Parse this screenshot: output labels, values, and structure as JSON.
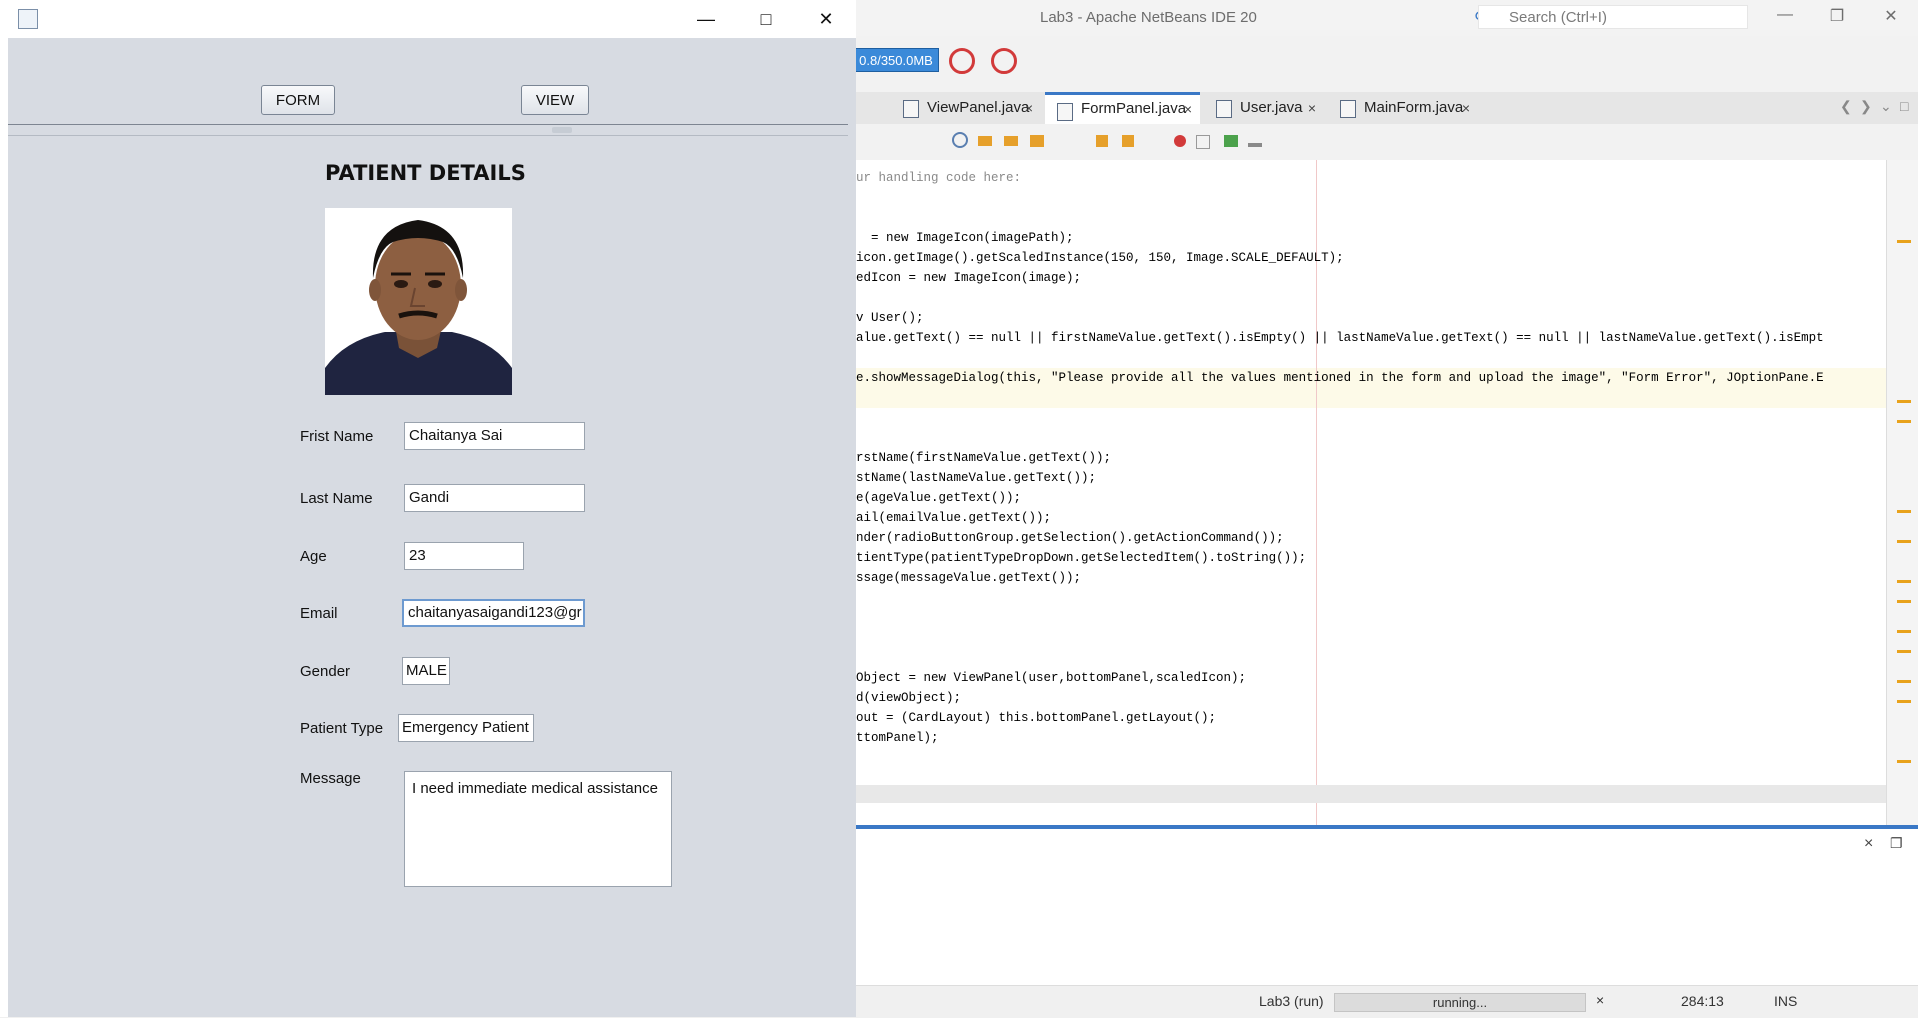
{
  "ide": {
    "title": "Lab3 - Apache NetBeans IDE 20",
    "search_placeholder": "Search (Ctrl+I)",
    "memory": "0.8/350.0MB",
    "tabs": [
      {
        "label": "ViewPanel.java"
      },
      {
        "label": "FormPanel.java"
      },
      {
        "label": "User.java"
      },
      {
        "label": "MainForm.java"
      }
    ],
    "close_glyph": "×",
    "code_lines": [
      "ur handling code here:",
      "  = new ImageIcon(imagePath);",
      "icon.getImage().getScaledInstance(150, 150, Image.SCALE_DEFAULT);",
      "edIcon = new ImageIcon(image);",
      "v User();",
      "alue.getText() == null || firstNameValue.getText().isEmpty() || lastNameValue.getText() == null || lastNameValue.getText().isEmpt",
      "e.showMessageDialog(this, \"Please provide all the values mentioned in the form and upload the image\", \"Form Error\", JOptionPane.E",
      "rstName(firstNameValue.getText());",
      "stName(lastNameValue.getText());",
      "e(ageValue.getText());",
      "ail(emailValue.getText());",
      "nder(radioButtonGroup.getSelection().getActionCommand());",
      "tientType(patientTypeDropDown.getSelectedItem().toString());",
      "ssage(messageValue.getText());",
      "Object = new ViewPanel(user,bottomPanel,scaledIcon);",
      "d(viewObject);",
      "out = (CardLayout) this.bottomPanel.getLayout();",
      "ttomPanel);"
    ],
    "status": {
      "project": "Lab3 (run)",
      "progress_text": "running...",
      "position": "284:13",
      "mode": "INS"
    }
  },
  "app": {
    "buttons": {
      "form": "FORM",
      "view": "VIEW"
    },
    "heading": "PATIENT DETAILS",
    "labels": {
      "first_name": "Frist Name",
      "last_name": "Last Name",
      "age": "Age",
      "email": "Email",
      "gender": "Gender",
      "patient_type": "Patient Type",
      "message": "Message"
    },
    "values": {
      "first_name": "Chaitanya Sai",
      "last_name": "Gandi",
      "age": "23",
      "email": "chaitanyasaigandi123@gr",
      "gender": "MALE",
      "patient_type": "Emergency Patient",
      "message": "I need immediate medical assistance"
    }
  }
}
